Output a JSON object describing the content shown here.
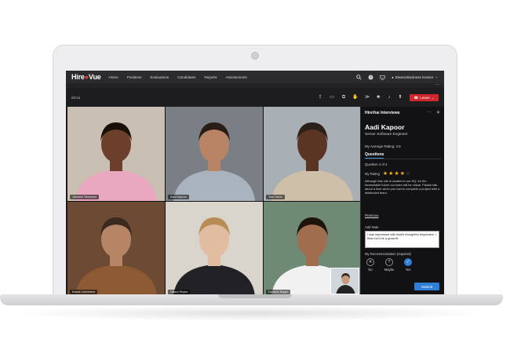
{
  "app": {
    "logo_text_a": "Hire",
    "logo_text_b": "Vue",
    "nav": [
      "Home",
      "Positions",
      "Evaluations",
      "Candidates",
      "Reports",
      "Assessments"
    ],
    "user_label": "EleanorBusiness Kramer",
    "accent": "#2f7fd8",
    "brand_red": "#e2352b"
  },
  "call": {
    "timer": "00:24",
    "leave_label": "Leave"
  },
  "tiles": [
    {
      "name": "Jasmine Simmons",
      "skin": "#6b3f2a",
      "hair": "#1a1008",
      "shirt": "#e9a7c0",
      "bg": "#c9bfb2"
    },
    {
      "name": "Aadi Kapoor",
      "skin": "#b98466",
      "hair": "#2a1d16",
      "shirt": "#a9b3bd",
      "bg": "#7a7f86"
    },
    {
      "name": "Tom Davis",
      "skin": "#5a3524",
      "hair": "#2b201a",
      "shirt": "#cdbfa8",
      "bg": "#a9b0b5"
    },
    {
      "name": "Kabok Unemmes",
      "skin": "#b58566",
      "hair": "#3a2a20",
      "shirt": "#8d5a34",
      "bg": "#6c4a34"
    },
    {
      "name": "Hillary Reyes",
      "skin": "#e2bca1",
      "hair": "#b78c55",
      "shirt": "#222226",
      "bg": "#d9d4cc"
    },
    {
      "name": "Danielle Bagini",
      "skin": "#a06d4f",
      "hair": "#1e140e",
      "shirt": "#f1f1f1",
      "bg": "#6f8a74"
    }
  ],
  "panel": {
    "title": "HireVue Interviews",
    "candidate_name": "Aadi Kapoor",
    "candidate_role": "Senior Software Engineer",
    "avg_rating": "My Average Rating: 4.5",
    "tab_questions": "Questions",
    "question_counter": "Question 4 of 4",
    "my_rating_label": "My Rating",
    "my_rating_value": 4,
    "my_rating_max": 5,
    "question_text": "Although this role is located in our HQ, for the foreseeable future our team will be virtual. Please talk about a time when you had to complete a project with a distributed team.",
    "previous_label": "Previous",
    "add_note_label": "Add Note",
    "note_value": "I was impressed with Aadi's thoughtful responses. I think he'd be a great fit.",
    "recommendation_label": "My Recommendation (required)",
    "options": [
      {
        "label": "No",
        "icon": "x-icon",
        "selected": false
      },
      {
        "label": "Maybe",
        "icon": "question-icon",
        "selected": false
      },
      {
        "label": "Yes",
        "icon": "check-icon",
        "selected": true
      }
    ],
    "submit_label": "Submit"
  }
}
